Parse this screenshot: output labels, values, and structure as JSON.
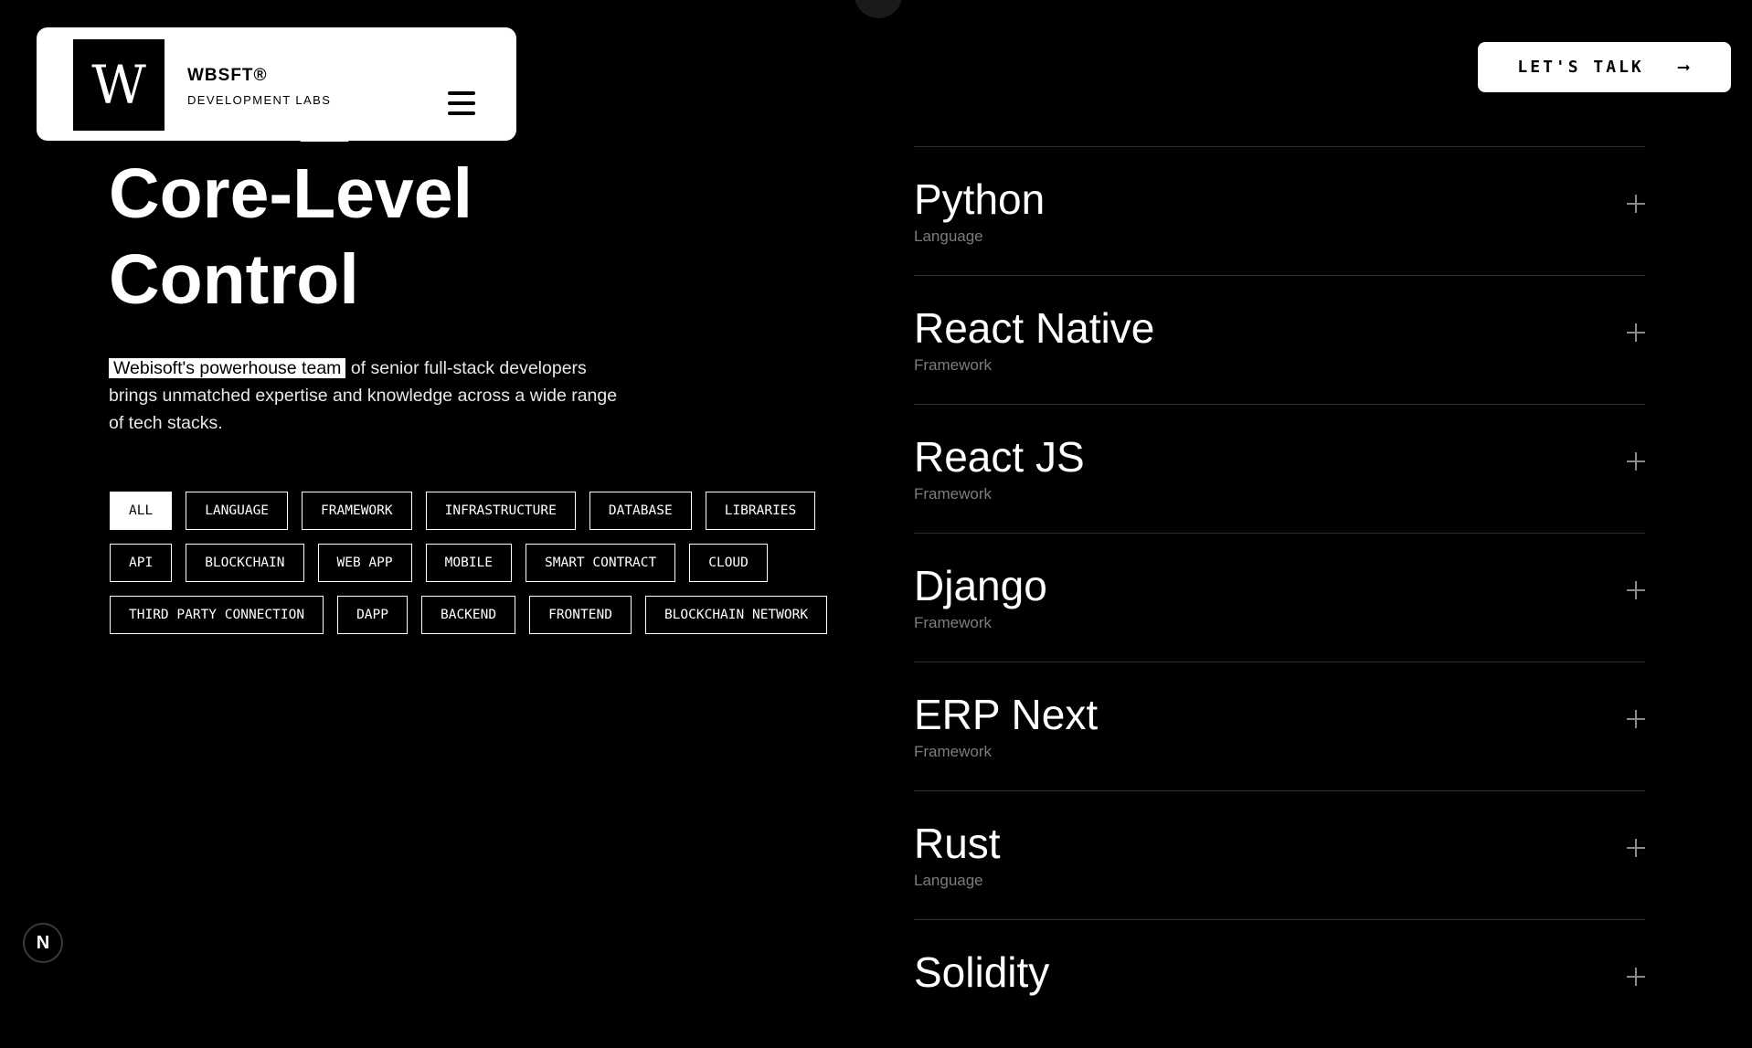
{
  "brand": {
    "logo_letter": "W",
    "name": "WBSFT®",
    "subtitle": "DEVELOPMENT LABS"
  },
  "cta": {
    "label": "LET'S TALK",
    "arrow": "⟶"
  },
  "hero": {
    "title_line1": "Core-Level",
    "title_line2": "Control",
    "intro_highlight": "Webisoft's powerhouse team",
    "intro_rest": " of senior full-stack developers brings unmatched expertise and knowledge across a wide range of tech stacks."
  },
  "filters": [
    {
      "label": "ALL",
      "active": true
    },
    {
      "label": "LANGUAGE",
      "active": false
    },
    {
      "label": "FRAMEWORK",
      "active": false
    },
    {
      "label": "INFRASTRUCTURE",
      "active": false
    },
    {
      "label": "DATABASE",
      "active": false
    },
    {
      "label": "LIBRARIES",
      "active": false
    },
    {
      "label": "API",
      "active": false
    },
    {
      "label": "BLOCKCHAIN",
      "active": false
    },
    {
      "label": "WEB APP",
      "active": false
    },
    {
      "label": "MOBILE",
      "active": false
    },
    {
      "label": "SMART CONTRACT",
      "active": false
    },
    {
      "label": "CLOUD",
      "active": false
    },
    {
      "label": "THIRD PARTY CONNECTION",
      "active": false
    },
    {
      "label": "DAPP",
      "active": false
    },
    {
      "label": "BACKEND",
      "active": false
    },
    {
      "label": "FRONTEND",
      "active": false
    },
    {
      "label": "BLOCKCHAIN NETWORK",
      "active": false
    }
  ],
  "tech": [
    {
      "name": "Python",
      "type": "Language"
    },
    {
      "name": "React Native",
      "type": "Framework"
    },
    {
      "name": "React JS",
      "type": "Framework"
    },
    {
      "name": "Django",
      "type": "Framework"
    },
    {
      "name": "ERP Next",
      "type": "Framework"
    },
    {
      "name": "Rust",
      "type": "Language"
    },
    {
      "name": "Solidity",
      "type": ""
    }
  ],
  "badge": {
    "letter": "N"
  }
}
